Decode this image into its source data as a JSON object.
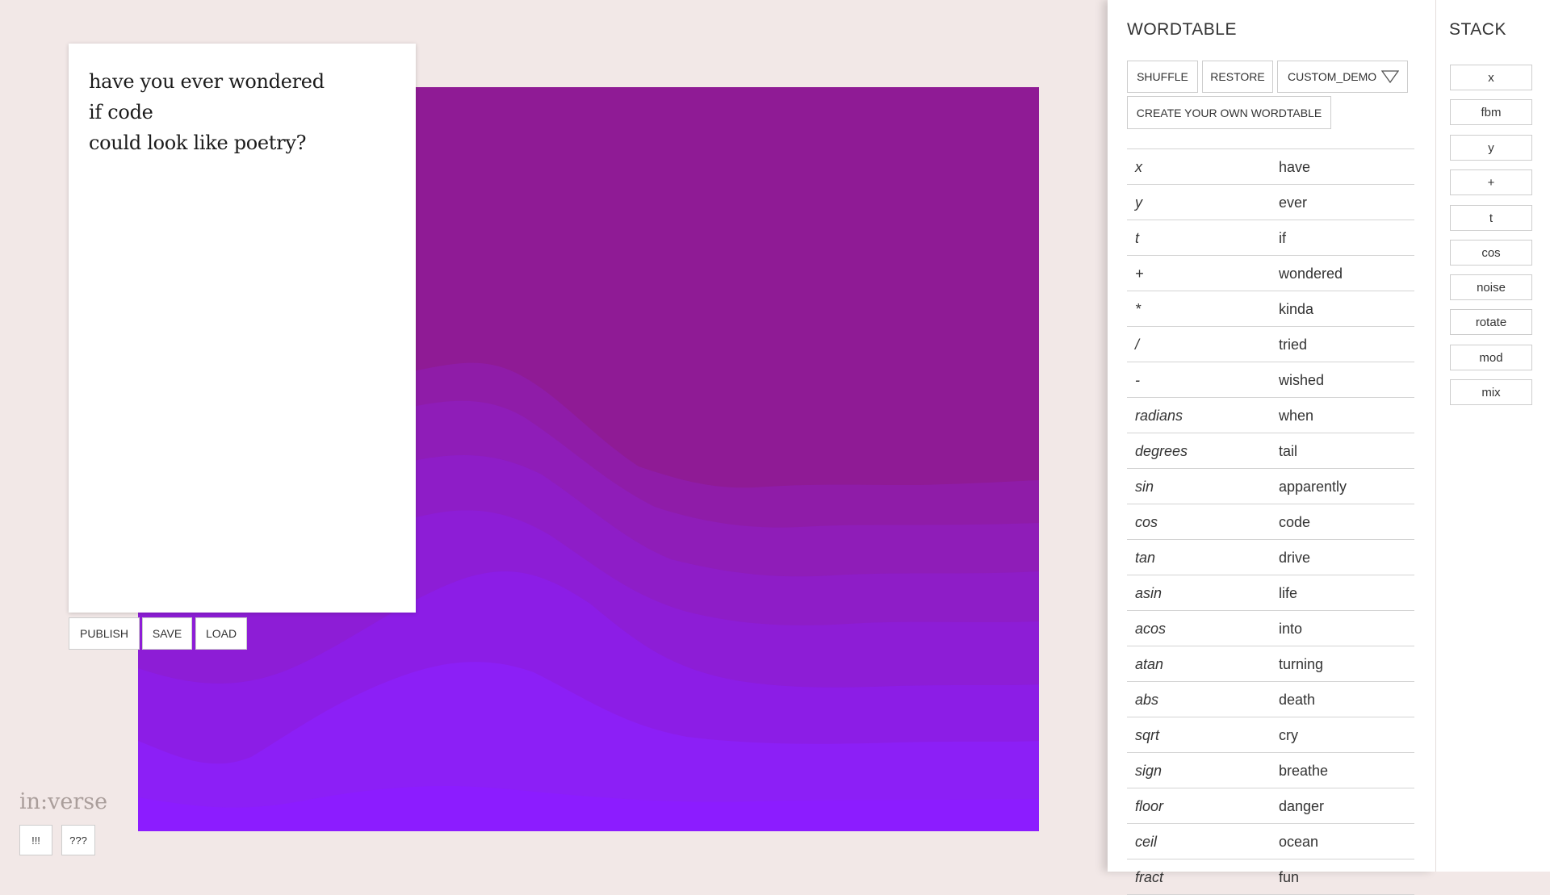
{
  "poem": {
    "lines": [
      "have you ever wondered",
      "if code",
      "could look like poetry?"
    ]
  },
  "editor_buttons": {
    "publish": "PUBLISH",
    "save": "SAVE",
    "load": "LOAD"
  },
  "logo": "in:verse",
  "footer_buttons": {
    "bang": "!!!",
    "query": "???"
  },
  "wordtable": {
    "title": "WORDTABLE",
    "shuffle": "SHUFFLE",
    "restore": "RESTORE",
    "selected_table": "CUSTOM_DEMO",
    "create": "CREATE YOUR OWN WORDTABLE",
    "rows": [
      {
        "key": "x",
        "word": "have"
      },
      {
        "key": "y",
        "word": "ever"
      },
      {
        "key": "t",
        "word": "if"
      },
      {
        "key": "+",
        "word": "wondered"
      },
      {
        "key": "*",
        "word": "kinda"
      },
      {
        "key": "/",
        "word": "tried"
      },
      {
        "key": "-",
        "word": "wished"
      },
      {
        "key": "radians",
        "word": "when"
      },
      {
        "key": "degrees",
        "word": "tail"
      },
      {
        "key": "sin",
        "word": "apparently"
      },
      {
        "key": "cos",
        "word": "code"
      },
      {
        "key": "tan",
        "word": "drive"
      },
      {
        "key": "asin",
        "word": "life"
      },
      {
        "key": "acos",
        "word": "into"
      },
      {
        "key": "atan",
        "word": "turning"
      },
      {
        "key": "abs",
        "word": "death"
      },
      {
        "key": "sqrt",
        "word": "cry"
      },
      {
        "key": "sign",
        "word": "breathe"
      },
      {
        "key": "floor",
        "word": "danger"
      },
      {
        "key": "ceil",
        "word": "ocean"
      },
      {
        "key": "fract",
        "word": "fun"
      }
    ]
  },
  "stack": {
    "title": "STACK",
    "items": [
      "x",
      "fbm",
      "y",
      "+",
      "t",
      "cos",
      "noise",
      "rotate",
      "mod",
      "mix"
    ]
  },
  "colors": {
    "art_top": "#8f1b95",
    "art_bottom": "#8c1cff"
  }
}
